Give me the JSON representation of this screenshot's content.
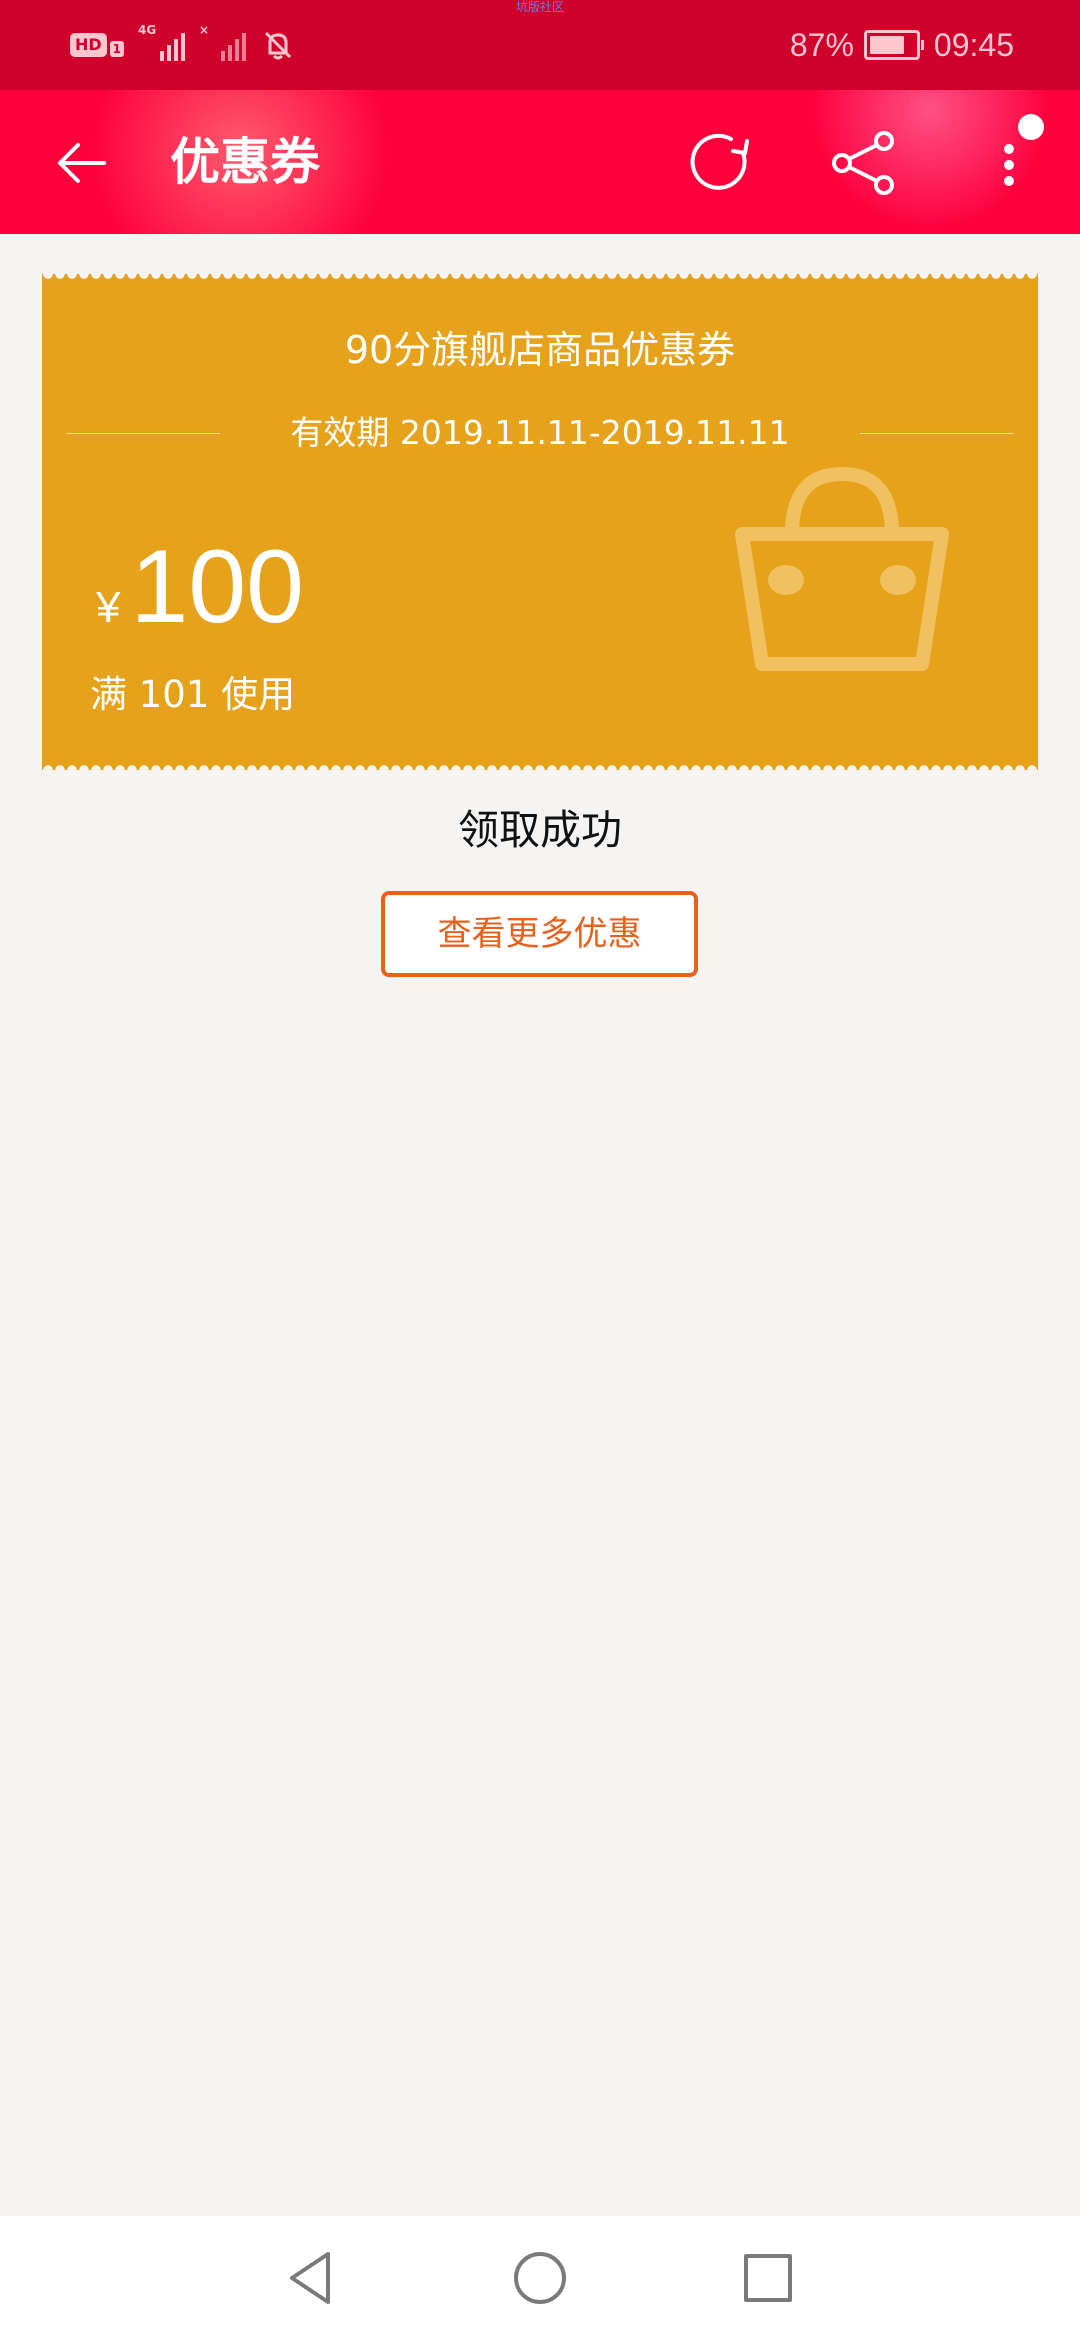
{
  "status_bar": {
    "top_label": "坑版社区",
    "hd_label": "HD",
    "sim_label": "1",
    "network_label": "4G",
    "no_sim_label": "×",
    "battery": "87%",
    "time": "09:45"
  },
  "header": {
    "title": "优惠券"
  },
  "coupon": {
    "title": "90分旗舰店商品优惠券",
    "validity": "有效期 2019.11.11-2019.11.11",
    "currency": "¥",
    "amount": "100",
    "min_spend": "满 101 使用",
    "background_color": "#e5a21a"
  },
  "main": {
    "success_message": "领取成功",
    "more_offers_label": "查看更多优惠"
  },
  "icons": {
    "back": "arrow-left-icon",
    "refresh": "refresh-icon",
    "share": "share-icon",
    "more": "more-vertical-icon",
    "watermark": "shopping-bag-icon",
    "nav_back": "triangle-back-icon",
    "nav_home": "circle-home-icon",
    "nav_recents": "square-recents-icon"
  },
  "colors": {
    "status_bar": "#d0002d",
    "app_bar": "#fe003c",
    "accent_orange": "#e8601a",
    "page_background": "#f5f4f2"
  }
}
